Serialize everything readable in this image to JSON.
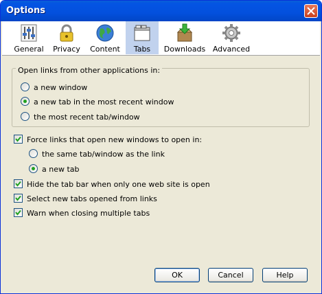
{
  "window": {
    "title": "Options"
  },
  "toolbar": {
    "items": [
      {
        "label": "General",
        "icon": "general-icon"
      },
      {
        "label": "Privacy",
        "icon": "lock-icon"
      },
      {
        "label": "Content",
        "icon": "globe-icon"
      },
      {
        "label": "Tabs",
        "icon": "tabs-icon",
        "selected": true
      },
      {
        "label": "Downloads",
        "icon": "download-box-icon"
      },
      {
        "label": "Advanced",
        "icon": "gear-icon"
      }
    ]
  },
  "open_links": {
    "legend": "Open links from other applications in:",
    "options": [
      {
        "label": "a new window",
        "checked": false
      },
      {
        "label": "a new tab in the most recent window",
        "checked": true
      },
      {
        "label": "the most recent tab/window",
        "checked": false
      }
    ]
  },
  "force_links": {
    "label": "Force links that open new windows to open in:",
    "checked": true,
    "options": [
      {
        "label": "the same tab/window as the link",
        "checked": false
      },
      {
        "label": "a new tab",
        "checked": true
      }
    ]
  },
  "checkboxes": [
    {
      "label": "Hide the tab bar when only one web site is open",
      "checked": true
    },
    {
      "label": "Select new tabs opened from links",
      "checked": true
    },
    {
      "label": "Warn when closing multiple tabs",
      "checked": true
    }
  ],
  "buttons": {
    "ok": "OK",
    "cancel": "Cancel",
    "help": "Help"
  },
  "colors": {
    "titlebar": "#0454e3",
    "dialog_bg": "#ece9d8",
    "selected_tab": "#c1d2ee"
  }
}
